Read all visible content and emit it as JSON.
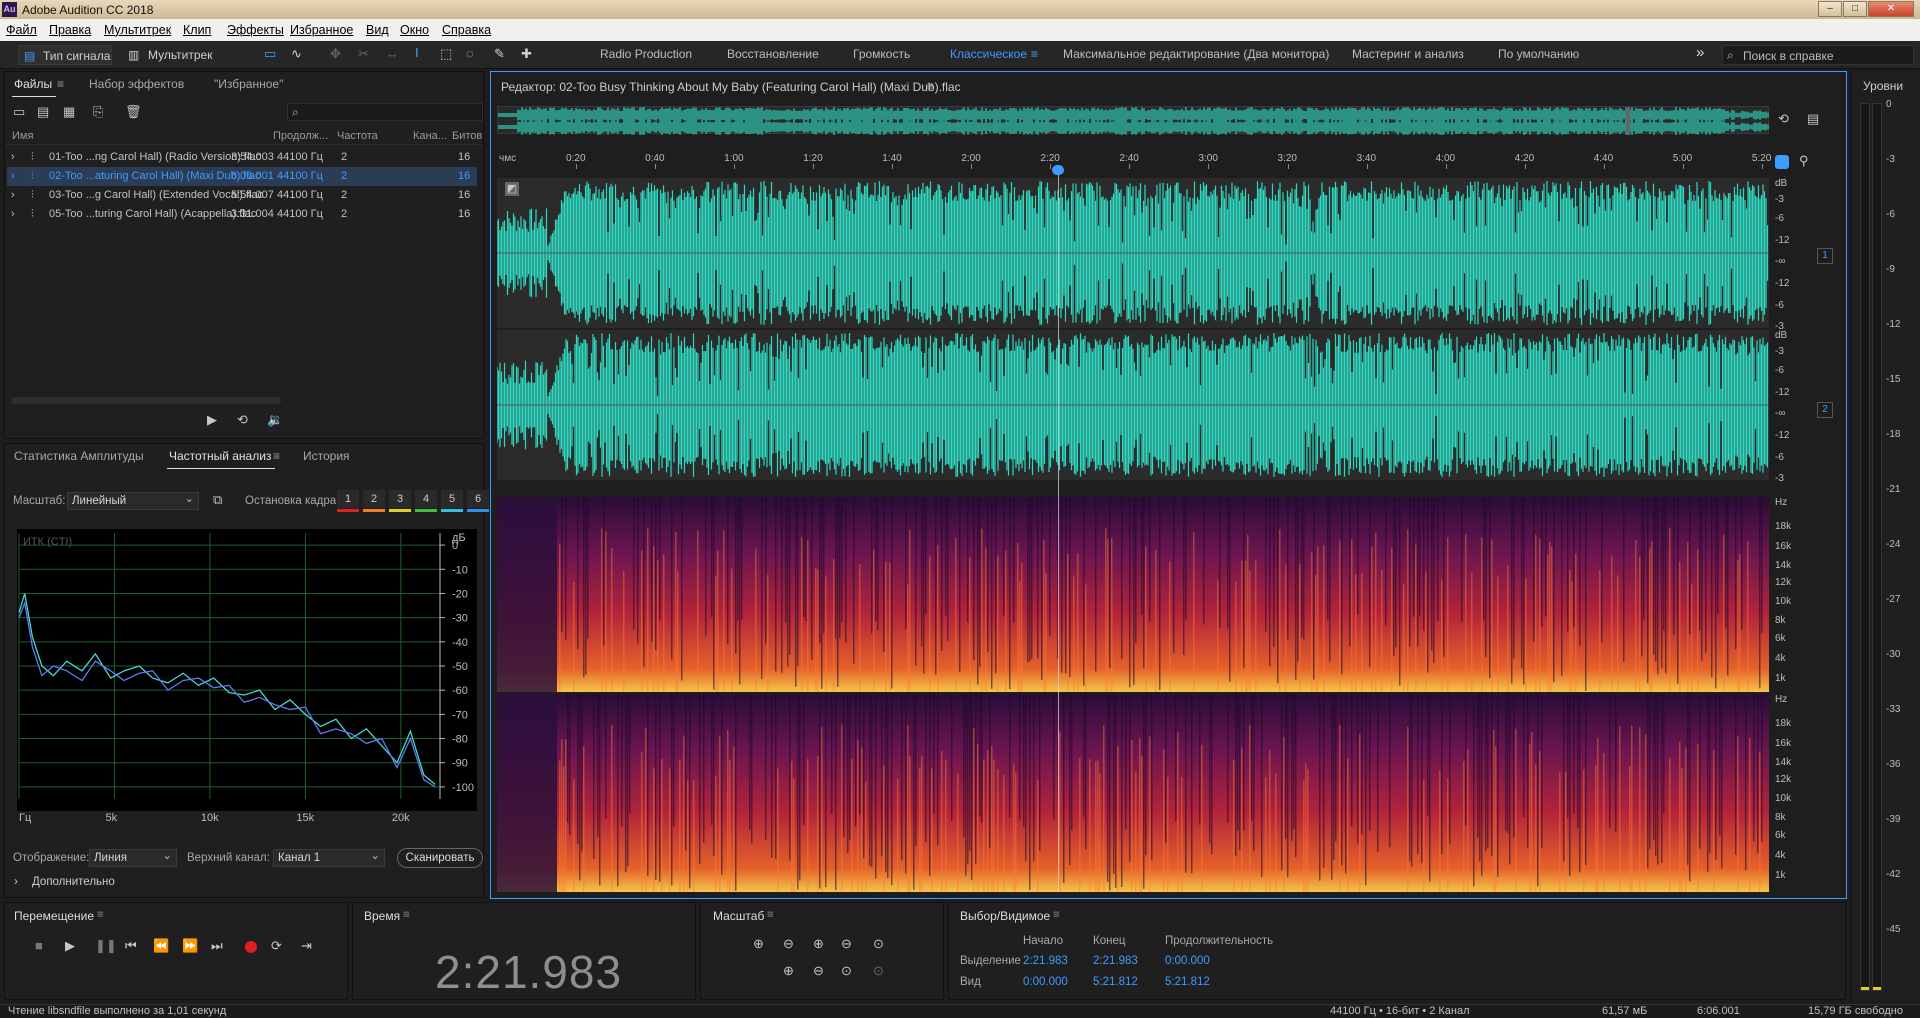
{
  "app": {
    "title": "Adobe Audition CC 2018",
    "logo": "Au",
    "bg_title": "Redaktor: 02-Too Busy Thinking About My Baby (Featuring Carol Hall) (Maxi Dub).flac"
  },
  "window_buttons": {
    "minimize": "–",
    "maximize": "□",
    "close": "✕"
  },
  "menu": [
    "Файл",
    "Правка",
    "Мультитрек",
    "Клип",
    "Эффекты",
    "Избранное",
    "Вид",
    "Окно",
    "Справка"
  ],
  "toolbar": {
    "mode_waveform": "Тип сигнала",
    "mode_multitrack": "Мультитрек",
    "workspaces": [
      "Radio Production",
      "Восстановление",
      "Громкость",
      "Классическое",
      "Максимальное редактирование (Два монитора)",
      "Мастеринг и анализ",
      "По умолчанию"
    ],
    "active_workspace": "Классическое",
    "more": "»",
    "search_placeholder": "Поиск в справке"
  },
  "files_panel": {
    "tabs": [
      "Файлы",
      "Набор эффектов",
      "\"Избранное\""
    ],
    "columns": [
      "Имя",
      "Продолж...",
      "Частота",
      "Кана...",
      "Битов"
    ],
    "search_icon": "⌕",
    "files": [
      {
        "name": "01-Too ...ng Carol Hall) (Radio Version).flac",
        "duration": "3:54.003",
        "rate": "44100 Гц",
        "channels": "2",
        "bits": "16",
        "selected": false
      },
      {
        "name": "02-Too ...aturing Carol Hall) (Maxi Dub).flac",
        "duration": "6:06.001",
        "rate": "44100 Гц",
        "channels": "2",
        "bits": "16",
        "selected": true
      },
      {
        "name": "03-Too ...g Carol Hall) (Extended Vocal).flac",
        "duration": "5:54.007",
        "rate": "44100 Гц",
        "channels": "2",
        "bits": "16",
        "selected": false
      },
      {
        "name": "05-Too ...turing Carol Hall) (Acappella).flac",
        "duration": "3:31.004",
        "rate": "44100 Гц",
        "channels": "2",
        "bits": "16",
        "selected": false
      }
    ]
  },
  "analysis_panel": {
    "tabs": [
      "Статистика Амплитуды",
      "Частотный анализ",
      "История"
    ],
    "scale_label": "Масштаб:",
    "scale_value": "Линейный",
    "freeze_label": "Остановка кадра:",
    "freeze_buttons": [
      "1",
      "2",
      "3",
      "4",
      "5",
      "6"
    ],
    "freeze_colors": [
      "#e02020",
      "#f08020",
      "#e0d020",
      "#40c040",
      "#30c0e0",
      "#3090f0"
    ],
    "display_label": "Отображение:",
    "display_value": "Линия",
    "channel_label": "Верхний канал:",
    "channel_value": "Канал 1",
    "scan_button": "Сканировать",
    "more_label": "Дополнительно"
  },
  "chart_data": {
    "type": "line",
    "title": "ИТК (CTI)",
    "xlabel": "",
    "ylabel": "дБ",
    "x_ticks": [
      "Гц",
      "5k",
      "10k",
      "15k",
      "20k"
    ],
    "y_ticks": [
      "0",
      "-10",
      "-20",
      "-30",
      "-40",
      "-50",
      "-60",
      "-70",
      "-80",
      "-90",
      "-100"
    ],
    "xlim": [
      0,
      22050
    ],
    "ylim": [
      -105,
      5
    ],
    "grid": true,
    "series": [
      {
        "color": "#49d6d0",
        "x": [
          0,
          300,
          700,
          1200,
          1800,
          2500,
          3300,
          4000,
          4800,
          5500,
          6300,
          7000,
          7800,
          8600,
          9400,
          10200,
          11000,
          11800,
          12600,
          13400,
          14200,
          15000,
          15800,
          16600,
          17400,
          18200,
          19000,
          19800,
          20500,
          21200,
          21800
        ],
        "y": [
          -28,
          -20,
          -38,
          -50,
          -54,
          -48,
          -52,
          -45,
          -55,
          -52,
          -50,
          -55,
          -57,
          -53,
          -58,
          -55,
          -61,
          -62,
          -60,
          -68,
          -64,
          -70,
          -75,
          -72,
          -80,
          -76,
          -83,
          -90,
          -77,
          -95,
          -99
        ]
      },
      {
        "color": "#5b7cf0",
        "x": [
          0,
          300,
          700,
          1200,
          1800,
          2500,
          3300,
          4000,
          4800,
          5500,
          6300,
          7000,
          7800,
          8600,
          9400,
          10200,
          11000,
          11800,
          12600,
          13400,
          14200,
          15000,
          15800,
          16600,
          17400,
          18200,
          19000,
          19800,
          20500,
          21200,
          21800
        ],
        "y": [
          -30,
          -24,
          -42,
          -54,
          -50,
          -52,
          -56,
          -48,
          -52,
          -56,
          -53,
          -52,
          -60,
          -56,
          -55,
          -59,
          -58,
          -65,
          -63,
          -66,
          -68,
          -67,
          -78,
          -76,
          -78,
          -82,
          -80,
          -92,
          -80,
          -97,
          -100
        ]
      }
    ]
  },
  "editor": {
    "title": "Редактор: 02-Too Busy Thinking About My Baby (Featuring Carol Hall) (Maxi Dub).flac",
    "ruler_unit": "чмс",
    "ruler_ticks": [
      "0:20",
      "0:40",
      "1:00",
      "1:20",
      "1:40",
      "2:00",
      "2:20",
      "2:40",
      "3:00",
      "3:20",
      "3:40",
      "4:00",
      "4:20",
      "4:40",
      "5:00",
      "5:20"
    ],
    "db_labels": [
      "dB",
      "-3",
      "-6",
      "-12",
      "-∞",
      "-12",
      "-6",
      "-3"
    ],
    "channel_badges": [
      "1",
      "2"
    ],
    "hz_labels": [
      "Hz",
      "18k",
      "16k",
      "14k",
      "12k",
      "10k",
      "8k",
      "6k",
      "4k",
      "1k"
    ],
    "playhead": "2:21.983",
    "waveform_color": "#2ed9c0"
  },
  "levels_panel": {
    "title": "Уровни",
    "ticks": [
      "0",
      "-3",
      "-6",
      "-9",
      "-12",
      "-15",
      "-18",
      "-21",
      "-24",
      "-27",
      "-30",
      "-33",
      "-36",
      "-39",
      "-42",
      "-45"
    ]
  },
  "transport": {
    "title": "Перемещение",
    "buttons": [
      "stop",
      "play",
      "pause",
      "to-start",
      "rewind",
      "fast-forward",
      "to-end",
      "record",
      "loop",
      "skip-selection"
    ]
  },
  "time_panel": {
    "title": "Время",
    "value": "2:21.983"
  },
  "zoom_panel": {
    "title": "Масштаб"
  },
  "selection_panel": {
    "title": "Выбор/Видимое",
    "headers": [
      "Начало",
      "Конец",
      "Продолжительность"
    ],
    "rows": [
      {
        "label": "Выделение",
        "start": "2:21.983",
        "end": "2:21.983",
        "duration": "0:00.000"
      },
      {
        "label": "Вид",
        "start": "0:00.000",
        "end": "5:21.812",
        "duration": "5:21.812"
      }
    ]
  },
  "status": {
    "message": "Чтение libsndfile выполнено за 1,01 секунд",
    "format": "44100 Гц • 16-бит • 2 Канал",
    "size": "61,57 мБ",
    "duration": "6:06.001",
    "free": "15,79 ГБ свободно"
  }
}
